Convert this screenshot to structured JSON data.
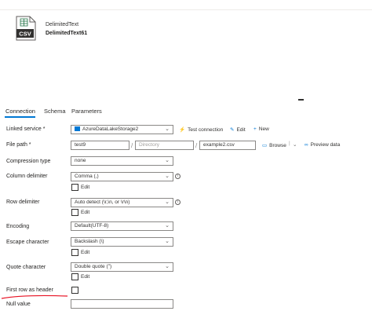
{
  "dataset": {
    "type_label": "DelimitedText",
    "name": "DelimitedText61",
    "icon_text": "CSV"
  },
  "tabs": [
    {
      "label": "Connection"
    },
    {
      "label": "Schema"
    },
    {
      "label": "Parameters"
    }
  ],
  "linked_service": {
    "label": "Linked service *",
    "value": "AzureDataLakeStorage2",
    "test_connection": "Test connection",
    "edit": "Edit",
    "new": "New"
  },
  "file_path": {
    "label": "File path *",
    "container": "test9",
    "directory_placeholder": "Directory",
    "file": "example2.csv",
    "browse": "Browse",
    "preview": "Preview data"
  },
  "compression_type": {
    "label": "Compression type",
    "value": "none"
  },
  "column_delimiter": {
    "label": "Column delimiter",
    "value": "Comma (,)",
    "edit": "Edit"
  },
  "row_delimiter": {
    "label": "Row delimiter",
    "value": "Auto detect (\\r,\\n, or \\r\\n)",
    "edit": "Edit"
  },
  "encoding": {
    "label": "Encoding",
    "value": "Default(UTF-8)"
  },
  "escape_character": {
    "label": "Escape character",
    "value": "Backslash (\\)",
    "edit": "Edit"
  },
  "quote_character": {
    "label": "Quote character",
    "value": "Double quote (\")",
    "edit": "Edit"
  },
  "first_row_header": {
    "label": "First row as header",
    "checked": false
  },
  "null_value": {
    "label": "Null value",
    "value": ""
  },
  "colors": {
    "accent": "#0078d4",
    "annotation": "#e81123"
  },
  "icons": {
    "dataset": "csv-file-icon",
    "test": "plug-icon",
    "edit": "pencil-icon",
    "new": "plus-icon",
    "browse": "folder-icon",
    "preview": "glasses-icon",
    "info": "info-icon"
  }
}
